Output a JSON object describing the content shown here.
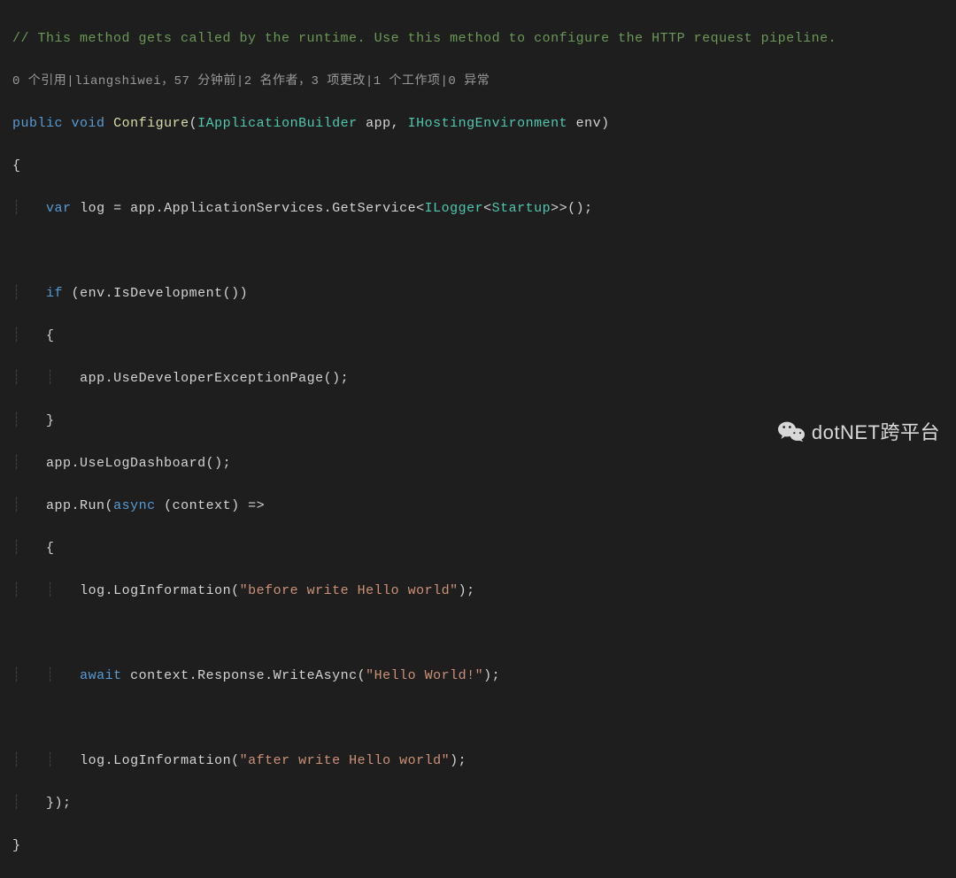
{
  "code": {
    "comment": "// This method gets called by the runtime. Use this method to configure the HTTP request pipeline.",
    "codelens": "0 个引用|liangshiwei，57 分钟前|2 名作者，3 项更改|1 个工作项|0 异常",
    "sig_public": "public",
    "sig_void": "void",
    "sig_method": "Configure",
    "sig_open": "(",
    "sig_t1": "IApplicationBuilder",
    "sig_p1": " app, ",
    "sig_t2": "IHostingEnvironment",
    "sig_p2": " env)",
    "brace_open": "{",
    "var_kw": "var",
    "var_name": " log = app.ApplicationServices.GetService<",
    "var_t1": "ILogger",
    "var_lt": "<",
    "var_t2": "Startup",
    "var_gt": ">>();",
    "if_kw": "if",
    "if_cond": " (env.IsDevelopment())",
    "if_open": "{",
    "if_body": "app.UseDeveloperExceptionPage();",
    "if_close": "}",
    "use_dash": "app.UseLogDashboard();",
    "run_head": "app.Run(",
    "run_async": "async",
    "run_param": " (context) =>",
    "run_open": "{",
    "log1_head": "log.LogInformation(",
    "log1_str": "\"before write Hello world\"",
    "log1_tail": ");",
    "await_kw": "await",
    "await_body": " context.Response.WriteAsync(",
    "await_str": "\"Hello World!\"",
    "await_tail": ");",
    "log2_head": "log.LogInformation(",
    "log2_str": "\"after write Hello world\"",
    "log2_tail": ");",
    "run_close": "});",
    "brace_close": "}"
  },
  "watermark": {
    "text": "dotNET跨平台"
  },
  "colors": {
    "background": "#1e1e1e",
    "comment": "#6a9955",
    "keyword": "#569cd6",
    "type": "#4ec9b0",
    "string": "#ce9178",
    "default": "#d4d4d4",
    "codelens": "#999999"
  }
}
